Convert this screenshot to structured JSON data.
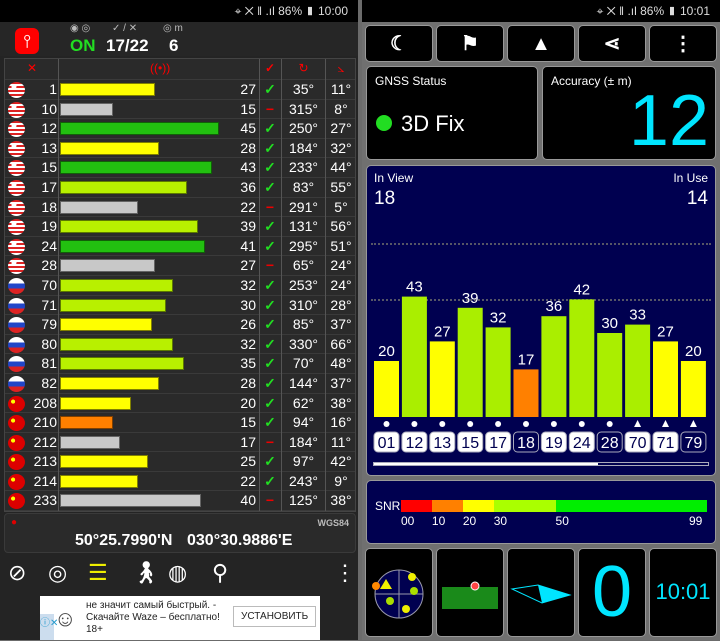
{
  "left": {
    "status_bar": {
      "battery": "86%",
      "time": "10:00"
    },
    "header": {
      "gps_label_icons": "gps-state",
      "gps_state": "ON",
      "sat_label": "✓ / ✕",
      "sats": "17/22",
      "acc_label": "m",
      "accuracy": "6",
      "state_color": "#22dd22"
    },
    "table": {
      "columns": [
        "satellite-icon",
        "signal-icon",
        "used-icon",
        "azimuth-icon",
        "elevation-icon"
      ],
      "rows": [
        {
          "flag": "us",
          "prn": "1",
          "snr": 27,
          "used": true,
          "az": "35°",
          "el": "11°"
        },
        {
          "flag": "us",
          "prn": "10",
          "snr": 15,
          "used": false,
          "az": "315°",
          "el": "8°"
        },
        {
          "flag": "us",
          "prn": "12",
          "snr": 45,
          "used": true,
          "az": "250°",
          "el": "27°"
        },
        {
          "flag": "us",
          "prn": "13",
          "snr": 28,
          "used": true,
          "az": "184°",
          "el": "32°"
        },
        {
          "flag": "us",
          "prn": "15",
          "snr": 43,
          "used": true,
          "az": "233°",
          "el": "44°"
        },
        {
          "flag": "us",
          "prn": "17",
          "snr": 36,
          "used": true,
          "az": "83°",
          "el": "55°"
        },
        {
          "flag": "us",
          "prn": "18",
          "snr": 22,
          "used": false,
          "az": "291°",
          "el": "5°"
        },
        {
          "flag": "us",
          "prn": "19",
          "snr": 39,
          "used": true,
          "az": "131°",
          "el": "56°"
        },
        {
          "flag": "us",
          "prn": "24",
          "snr": 41,
          "used": true,
          "az": "295°",
          "el": "51°"
        },
        {
          "flag": "us",
          "prn": "28",
          "snr": 27,
          "used": false,
          "az": "65°",
          "el": "24°"
        },
        {
          "flag": "ru",
          "prn": "70",
          "snr": 32,
          "used": true,
          "az": "253°",
          "el": "24°"
        },
        {
          "flag": "ru",
          "prn": "71",
          "snr": 30,
          "used": true,
          "az": "310°",
          "el": "28°"
        },
        {
          "flag": "ru",
          "prn": "79",
          "snr": 26,
          "used": true,
          "az": "85°",
          "el": "37°"
        },
        {
          "flag": "ru",
          "prn": "80",
          "snr": 32,
          "used": true,
          "az": "330°",
          "el": "66°"
        },
        {
          "flag": "ru",
          "prn": "81",
          "snr": 35,
          "used": true,
          "az": "70°",
          "el": "48°"
        },
        {
          "flag": "ru",
          "prn": "82",
          "snr": 28,
          "used": true,
          "az": "144°",
          "el": "37°"
        },
        {
          "flag": "cn",
          "prn": "208",
          "snr": 20,
          "used": true,
          "az": "62°",
          "el": "38°"
        },
        {
          "flag": "cn",
          "prn": "210",
          "snr": 15,
          "used": true,
          "az": "94°",
          "el": "16°"
        },
        {
          "flag": "cn",
          "prn": "212",
          "snr": 17,
          "used": false,
          "az": "184°",
          "el": "11°"
        },
        {
          "flag": "cn",
          "prn": "213",
          "snr": 25,
          "used": true,
          "az": "97°",
          "el": "42°"
        },
        {
          "flag": "cn",
          "prn": "214",
          "snr": 22,
          "used": true,
          "az": "243°",
          "el": "9°"
        },
        {
          "flag": "cn",
          "prn": "233",
          "snr": 40,
          "used": false,
          "az": "125°",
          "el": "38°"
        }
      ]
    },
    "coords": {
      "datum": "WGS84",
      "lat": "50°25.7990'N",
      "lon": "030°30.9886'E"
    },
    "nav_icons": [
      "compass",
      "radar",
      "signal-bars",
      "walk",
      "globe",
      "map-pin",
      "more"
    ],
    "ad": {
      "line1": "не значит самый быстрый. -",
      "line2": "Скачайте Waze – бесплатно!",
      "line3": "18+",
      "button": "УСТАНОВИТЬ"
    }
  },
  "right": {
    "status_bar": {
      "battery": "86%",
      "time": "10:01"
    },
    "toolbar": [
      "moon",
      "person-flag",
      "navigation-arrow",
      "share",
      "more"
    ],
    "gnss": {
      "title": "GNSS Status",
      "value": "3D Fix",
      "dot_color": "#22dd22"
    },
    "accuracy": {
      "title": "Accuracy (± m)",
      "value": "12"
    },
    "view": {
      "in_view_label": "In View",
      "in_view": "18",
      "in_use_label": "In Use",
      "in_use": "14"
    },
    "chart_data": {
      "type": "bar",
      "categories": [
        "01",
        "12",
        "13",
        "15",
        "17",
        "18",
        "19",
        "24",
        "28",
        "70",
        "71",
        "79"
      ],
      "values": [
        20,
        43,
        27,
        39,
        32,
        17,
        36,
        42,
        30,
        33,
        27,
        20
      ],
      "used": [
        true,
        true,
        true,
        true,
        true,
        false,
        true,
        true,
        false,
        true,
        true,
        false
      ],
      "markers": [
        "circle",
        "circle",
        "circle",
        "circle",
        "circle",
        "circle",
        "circle",
        "circle",
        "circle",
        "triangle",
        "triangle",
        "triangle"
      ],
      "scroll_fraction": 0.67
    },
    "snr": {
      "label": "SNR",
      "ticks": [
        "00",
        "10",
        "20",
        "30",
        "50",
        "99"
      ],
      "colors": [
        "#ff0000",
        "#ff8000",
        "#ffff00",
        "#aaff00",
        "#00ee00"
      ]
    },
    "tiles": {
      "speed": "0",
      "time": "10:01"
    }
  }
}
